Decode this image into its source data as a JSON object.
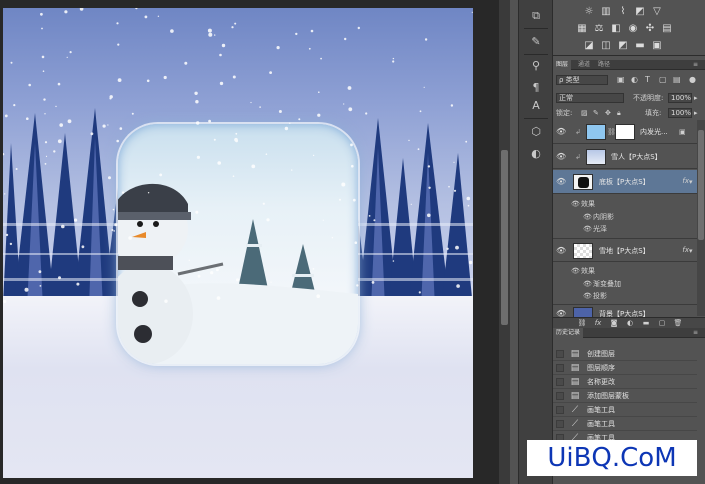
{
  "layers_panel": {
    "tabs": [
      {
        "label": "图层",
        "active": true
      },
      {
        "label": "通道",
        "active": false
      },
      {
        "label": "路径",
        "active": false
      }
    ],
    "filter_kind": "ρ 类型",
    "blend_mode": "正常",
    "opacity_label": "不透明度:",
    "opacity_value": "100%",
    "lock_label": "锁定:",
    "fill_label": "填充:",
    "fill_value": "100%",
    "layers": [
      {
        "name": "内发光...",
        "selected": false,
        "fx": false
      },
      {
        "name": "雪人【P大点S】",
        "selected": false,
        "fx": false
      },
      {
        "name": "底板【P大点S】",
        "selected": true,
        "fx": true
      },
      {
        "name": "雪地【P大点S】",
        "selected": false,
        "fx": true
      },
      {
        "name": "背景【P大点S】",
        "selected": false,
        "fx": false
      }
    ],
    "effects_base": {
      "label": "效果",
      "items": [
        "内阴影",
        "光泽"
      ]
    },
    "effects_snow": {
      "label": "效果",
      "items": [
        "渐变叠加",
        "投影"
      ]
    }
  },
  "history_panel": {
    "tab": "历史记录",
    "items": [
      {
        "label": "创建图层",
        "icon": "document-icon"
      },
      {
        "label": "图层顺序",
        "icon": "document-icon"
      },
      {
        "label": "名称更改",
        "icon": "document-icon"
      },
      {
        "label": "添加图层蒙板",
        "icon": "document-icon"
      },
      {
        "label": "画笔工具",
        "icon": "brush-icon"
      },
      {
        "label": "画笔工具",
        "icon": "brush-icon"
      },
      {
        "label": "画笔工具",
        "icon": "brush-icon"
      },
      {
        "label": "画笔工具",
        "icon": "brush-icon"
      }
    ]
  },
  "watermark": {
    "text": "UiBQ.CoM"
  },
  "colors": {
    "panel_bg": "#535353",
    "selection": "#5e7796",
    "watermark_text": "#0d36b5"
  }
}
